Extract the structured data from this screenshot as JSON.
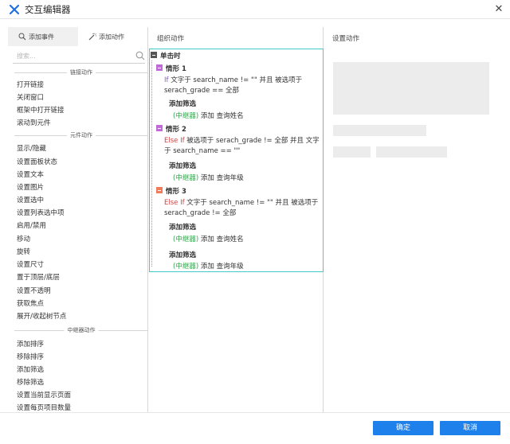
{
  "window": {
    "title": "交互编辑器",
    "close_glyph": "✕",
    "accent": "#1e80ea",
    "logo_color": "#1f6fe0"
  },
  "left": {
    "tabs": [
      {
        "label": "添加事件",
        "icon": "event-icon"
      },
      {
        "label": "添加动作",
        "icon": "wand-icon"
      }
    ],
    "search_placeholder": "搜索...",
    "sections": [
      {
        "title": "链接动作",
        "items": [
          "打开链接",
          "关闭窗口",
          "框架中打开链接",
          "滚动到元件"
        ]
      },
      {
        "title": "元件动作",
        "items": [
          "显示/隐藏",
          "设置面板状态",
          "设置文本",
          "设置图片",
          "设置选中",
          "设置列表选中项",
          "启用/禁用",
          "移动",
          "旋转",
          "设置尺寸",
          "置于顶层/底层",
          "设置不透明",
          "获取焦点",
          "展开/收起树节点"
        ]
      },
      {
        "title": "中继器动作",
        "items": [
          "添加排序",
          "移除排序",
          "添加筛选",
          "移除筛选",
          "设置当前显示页面",
          "设置每页项目数量"
        ]
      }
    ]
  },
  "middle": {
    "title": "组织动作",
    "event": "单击时",
    "cases": [
      {
        "name": "情形 1",
        "keyword": "If",
        "condition_lines": [
          "文字于 search_name != \"\" 并且 被选项于",
          "serach_grade == 全部"
        ],
        "icon_color": "#c06bd8"
      },
      {
        "name": "情形 2",
        "keyword": "Else If",
        "condition_lines": [
          "被选项于 serach_grade != 全部 并且 文字",
          "于 search_name == \"\""
        ],
        "icon_color": "#c06bd8"
      },
      {
        "name": "情形 3",
        "keyword": "Else If",
        "condition_lines": [
          "文字于 search_name != \"\" 并且 被选项于",
          "serach_grade != 全部"
        ],
        "icon_color": "#f07c5a"
      }
    ],
    "filter_label": "添加筛选",
    "repeater_label": "(中继器)",
    "add_text": "添加",
    "filter_name": "查询姓名",
    "filter_grade": "查询年级",
    "event_icon_color": "#555555",
    "tree_border": "#46c9c9"
  },
  "right": {
    "title": "设置动作"
  },
  "footer": {
    "ok": "确定",
    "cancel": "取消"
  }
}
